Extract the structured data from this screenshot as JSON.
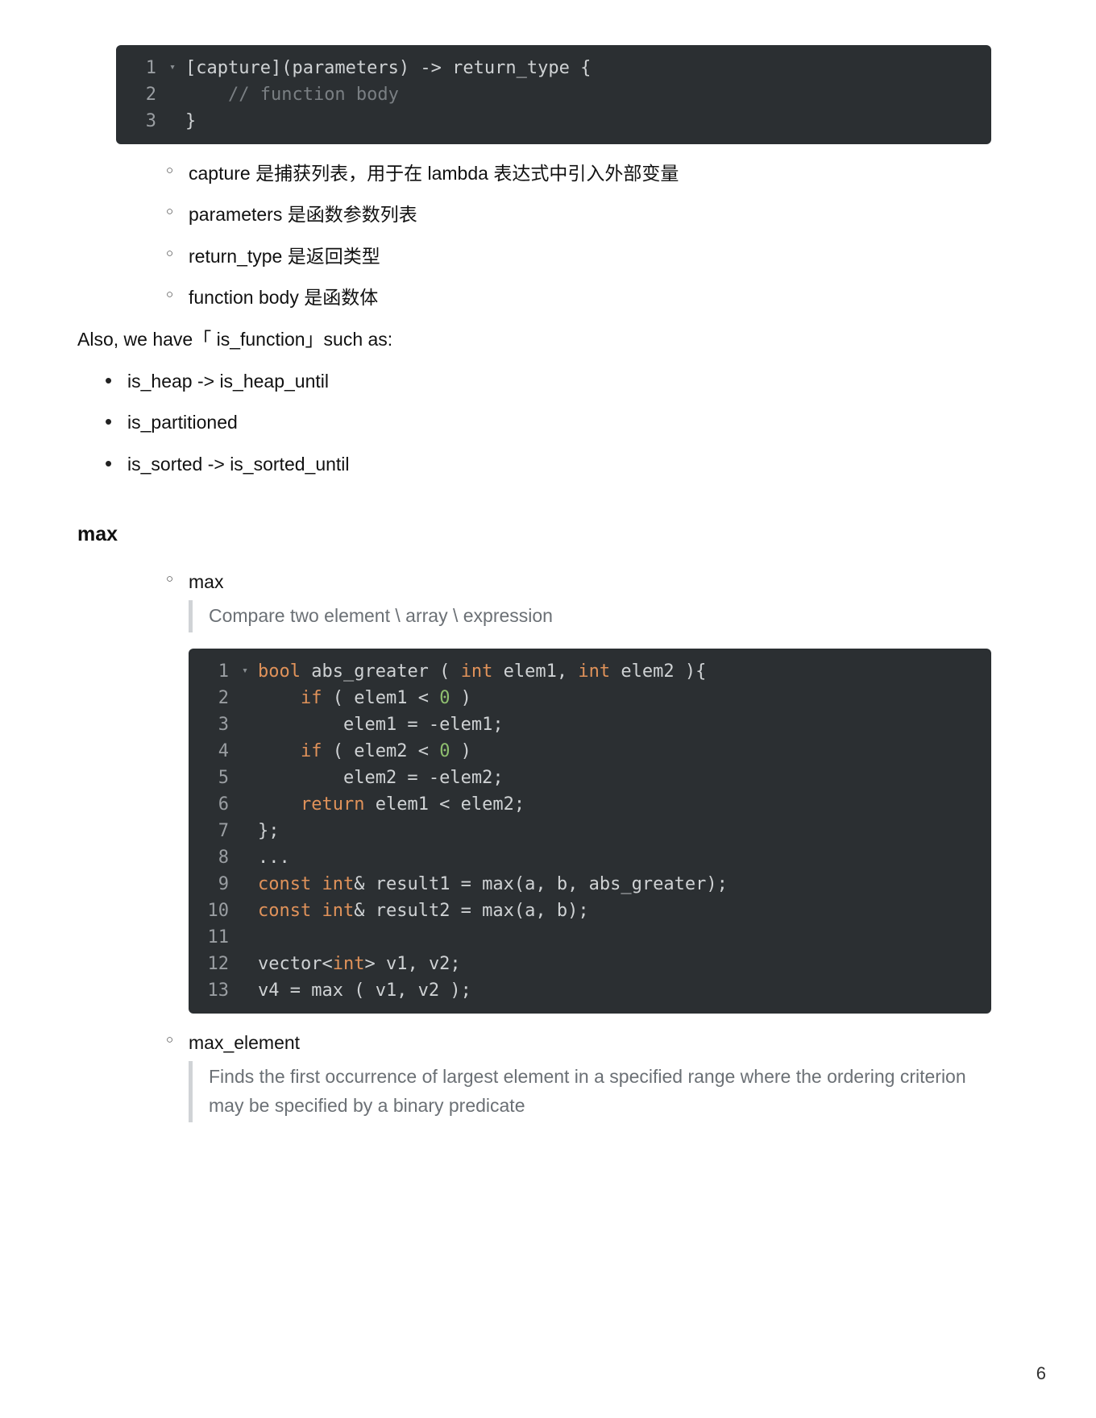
{
  "page_number": "6",
  "code1": {
    "lines": [
      {
        "n": "1",
        "fold": true,
        "tokens": [
          {
            "t": "[capture](parameters) -> return_type {",
            "c": "tok-ident"
          }
        ]
      },
      {
        "n": "2",
        "fold": false,
        "tokens": [
          {
            "t": "    ",
            "c": ""
          },
          {
            "t": "// function body",
            "c": "tok-cmt"
          }
        ]
      },
      {
        "n": "3",
        "fold": false,
        "tokens": [
          {
            "t": "}",
            "c": "tok-ident"
          }
        ]
      }
    ]
  },
  "lambda_notes": [
    "capture 是捕获列表，用于在 lambda 表达式中引入外部变量",
    "parameters 是函数参数列表",
    "return_type 是返回类型",
    "function body 是函数体"
  ],
  "is_function_intro": "Also, we have「 is_function」such as:",
  "is_functions": [
    "is_heap -> is_heap_until",
    "is_partitioned",
    "is_sorted -> is_sorted_until"
  ],
  "section_max_title": "max",
  "max_item_label": "max",
  "max_quote": "Compare two element \\ array \\ expression",
  "code2": {
    "lines": [
      {
        "n": "1",
        "fold": true,
        "tokens": [
          {
            "t": "bool",
            "c": "tok-type"
          },
          {
            "t": " ",
            "c": ""
          },
          {
            "t": "abs_greater",
            "c": "tok-ident"
          },
          {
            "t": " ( ",
            "c": "tok-punct"
          },
          {
            "t": "int",
            "c": "tok-type"
          },
          {
            "t": " elem1, ",
            "c": "tok-ident"
          },
          {
            "t": "int",
            "c": "tok-type"
          },
          {
            "t": " elem2 ){",
            "c": "tok-ident"
          }
        ]
      },
      {
        "n": "2",
        "fold": false,
        "tokens": [
          {
            "t": "    ",
            "c": ""
          },
          {
            "t": "if",
            "c": "tok-kw"
          },
          {
            "t": " ( elem1 < ",
            "c": "tok-ident"
          },
          {
            "t": "0",
            "c": "tok-num"
          },
          {
            "t": " )",
            "c": "tok-ident"
          }
        ]
      },
      {
        "n": "3",
        "fold": false,
        "tokens": [
          {
            "t": "        elem1 = -elem1;",
            "c": "tok-ident"
          }
        ]
      },
      {
        "n": "4",
        "fold": false,
        "tokens": [
          {
            "t": "    ",
            "c": ""
          },
          {
            "t": "if",
            "c": "tok-kw"
          },
          {
            "t": " ( elem2 < ",
            "c": "tok-ident"
          },
          {
            "t": "0",
            "c": "tok-num"
          },
          {
            "t": " )",
            "c": "tok-ident"
          }
        ]
      },
      {
        "n": "5",
        "fold": false,
        "tokens": [
          {
            "t": "        elem2 = -elem2;",
            "c": "tok-ident"
          }
        ]
      },
      {
        "n": "6",
        "fold": false,
        "tokens": [
          {
            "t": "    ",
            "c": ""
          },
          {
            "t": "return",
            "c": "tok-return"
          },
          {
            "t": " elem1 < elem2;",
            "c": "tok-ident"
          }
        ]
      },
      {
        "n": "7",
        "fold": false,
        "tokens": [
          {
            "t": "};",
            "c": "tok-ident"
          }
        ]
      },
      {
        "n": "8",
        "fold": false,
        "tokens": [
          {
            "t": "...",
            "c": "tok-ident"
          }
        ]
      },
      {
        "n": "9",
        "fold": false,
        "tokens": [
          {
            "t": "const",
            "c": "tok-kw"
          },
          {
            "t": " ",
            "c": ""
          },
          {
            "t": "int",
            "c": "tok-type"
          },
          {
            "t": "& result1 = max(a, b, abs_greater);",
            "c": "tok-ident"
          }
        ]
      },
      {
        "n": "10",
        "fold": false,
        "tokens": [
          {
            "t": "const",
            "c": "tok-kw"
          },
          {
            "t": " ",
            "c": ""
          },
          {
            "t": "int",
            "c": "tok-type"
          },
          {
            "t": "& result2 = max(a, b);",
            "c": "tok-ident"
          }
        ]
      },
      {
        "n": "11",
        "fold": false,
        "tokens": [
          {
            "t": "",
            "c": ""
          }
        ]
      },
      {
        "n": "12",
        "fold": false,
        "tokens": [
          {
            "t": "vector<",
            "c": "tok-ident"
          },
          {
            "t": "int",
            "c": "tok-type"
          },
          {
            "t": "> v1, v2;",
            "c": "tok-ident"
          }
        ]
      },
      {
        "n": "13",
        "fold": false,
        "tokens": [
          {
            "t": "v4 = max ( v1, v2 );",
            "c": "tok-ident"
          }
        ]
      }
    ]
  },
  "max_element_label": "max_element",
  "max_element_quote": "Finds the first occurrence of largest element in a specified range where the ordering criterion may be specified by a binary predicate"
}
